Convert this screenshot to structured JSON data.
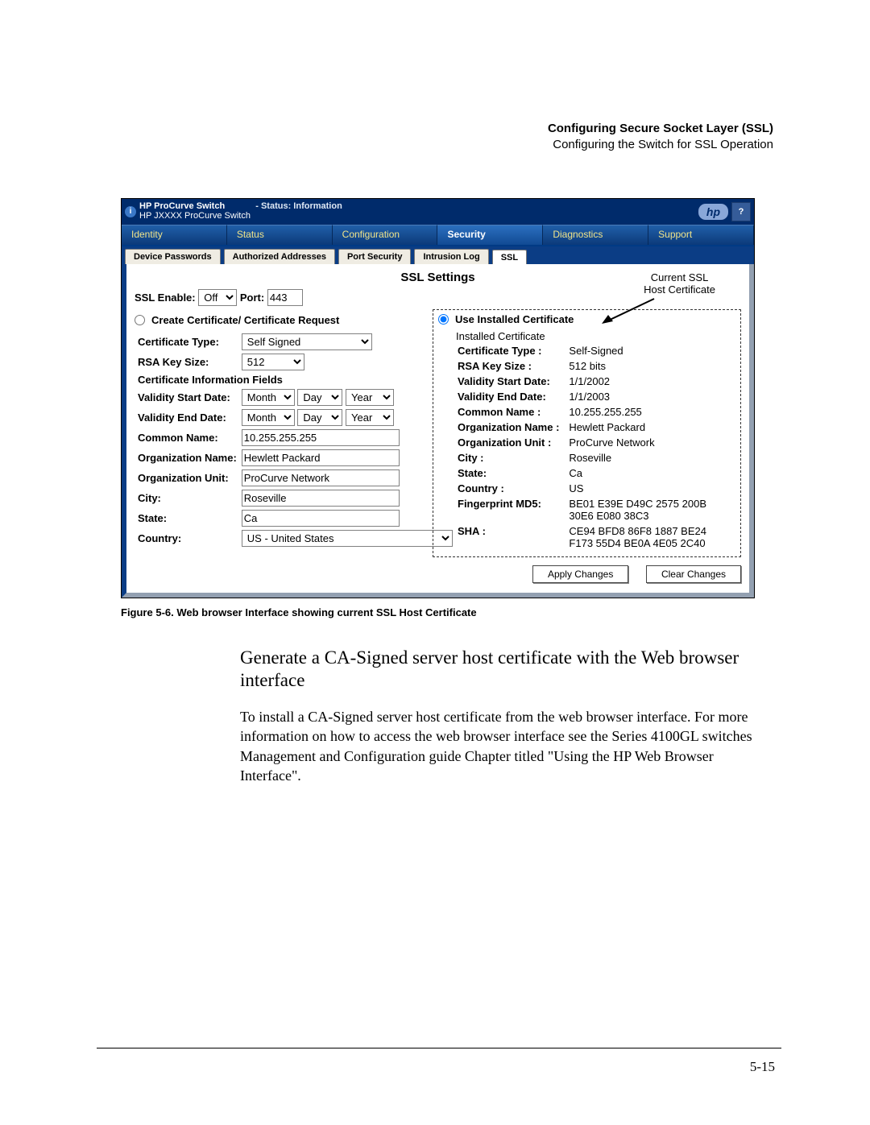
{
  "doc": {
    "header_bold": "Configuring Secure Socket Layer (SSL)",
    "header_sub": "Configuring the Switch for SSL Operation",
    "caption": "Figure 5-6. Web browser Interface showing current SSL Host Certificate",
    "heading": "Generate a CA-Signed server host certificate with the Web browser interface",
    "para": "To install a CA-Signed server host certificate from the web browser interface. For more information on how to access the web browser interface  see the Series 4100GL switches Management and Configuration guide Chapter titled \"Using the HP Web Browser Interface\".",
    "page_num": "5-15"
  },
  "titlebar": {
    "title": "HP ProCurve Switch",
    "subtitle": "HP JXXXX ProCurve Switch",
    "status_label": "- Status:  Information",
    "logo": "hp",
    "help": "?"
  },
  "main_tabs": [
    "Identity",
    "Status",
    "Configuration",
    "Security",
    "Diagnostics",
    "Support"
  ],
  "sub_tabs": [
    "Device Passwords",
    "Authorized Addresses",
    "Port Security",
    "Intrusion Log",
    "SSL"
  ],
  "panel": {
    "title": "SSL Settings",
    "side_label": "Current SSL\nHost Certificate",
    "ssl_enable_label": "SSL Enable:",
    "ssl_enable_value": "Off",
    "port_label": "Port:",
    "port_value": "443"
  },
  "left": {
    "radio": "Create Certificate/ Certificate Request",
    "cert_type_label": "Certificate Type:",
    "cert_type_value": "Self Signed",
    "rsa_label": "RSA Key Size:",
    "rsa_value": "512",
    "section": "Certificate Information Fields",
    "vstart_label": "Validity Start Date:",
    "vend_label": "Validity End Date:",
    "month": "Month",
    "day": "Day",
    "year": "Year",
    "common_label": "Common Name:",
    "common_value": "10.255.255.255",
    "org_label": "Organization Name:",
    "org_value": "Hewlett Packard",
    "ou_label": "Organization Unit:",
    "ou_value": "ProCurve Network",
    "city_label": "City:",
    "city_value": "Roseville",
    "state_label": "State:",
    "state_value": "Ca",
    "country_label": "Country:",
    "country_value": "US - United States"
  },
  "right": {
    "radio": "Use Installed Certificate",
    "installed_header": "Installed Certificate",
    "rows": {
      "type_l": "Certificate Type :",
      "type_v": "Self-Signed",
      "rsa_l": "RSA Key Size :",
      "rsa_v": "512 bits",
      "vs_l": "Validity Start Date:",
      "vs_v": "1/1/2002",
      "ve_l": "Validity End Date:",
      "ve_v": "1/1/2003",
      "cn_l": "Common Name :",
      "cn_v": "10.255.255.255",
      "on_l": "Organization Name :",
      "on_v": "Hewlett Packard",
      "ou_l": "Organization Unit :",
      "ou_v": "ProCurve Network",
      "ci_l": "City :",
      "ci_v": "Roseville",
      "st_l": "State:",
      "st_v": "Ca",
      "co_l": "Country :",
      "co_v": "US",
      "md5_l": "Fingerprint MD5:",
      "md5_v": "BE01 E39E D49C 2575 200B 30E6 E080 38C3",
      "sha_l": "SHA :",
      "sha_v": "CE94 BFD8 86F8 1887 BE24 F173 55D4 BE0A 4E05 2C40"
    }
  },
  "buttons": {
    "apply": "Apply Changes",
    "clear": "Clear Changes"
  }
}
